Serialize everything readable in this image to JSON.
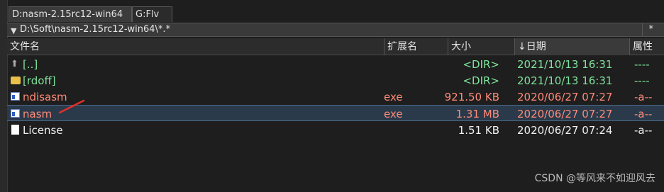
{
  "tabs": [
    {
      "label": "D:nasm-2.15rc12-win64",
      "active": true
    },
    {
      "label": "G:Flv",
      "active": false
    }
  ],
  "path": {
    "value": "D:\\Soft\\nasm-2.15rc12-win64\\*.*",
    "filter_symbol": "*"
  },
  "columns": {
    "name": "文件名",
    "ext": "扩展名",
    "size": "大小",
    "date": "日期",
    "attr": "属性",
    "sort_indicator": "↓"
  },
  "files": [
    {
      "icon": "up-arrow-icon",
      "name": "[..]",
      "ext": "",
      "size": "<DIR>",
      "date": "2021/10/13 16:31",
      "attr": "----",
      "color": "#7fe39b"
    },
    {
      "icon": "folder-icon",
      "name": "[rdoff]",
      "ext": "",
      "size": "<DIR>",
      "date": "2021/10/13 16:31",
      "attr": "----",
      "color": "#7fe39b"
    },
    {
      "icon": "exe-icon",
      "name": "ndisasm",
      "ext": "exe",
      "size": "921.50 KB",
      "date": "2020/06/27 07:27",
      "attr": "-a--",
      "color": "#ff8a78"
    },
    {
      "icon": "exe-icon",
      "name": "nasm",
      "ext": "exe",
      "size": "1.31 MB",
      "date": "2020/06/27 07:27",
      "attr": "-a--",
      "color": "#ff8a78",
      "selected": true
    },
    {
      "icon": "file-icon",
      "name": "License",
      "ext": "",
      "size": "1.51 KB",
      "date": "2020/06/27 07:24",
      "attr": "-a--",
      "color": "#f0f0f0"
    }
  ],
  "watermark": "CSDN @等风来不如迎风去"
}
